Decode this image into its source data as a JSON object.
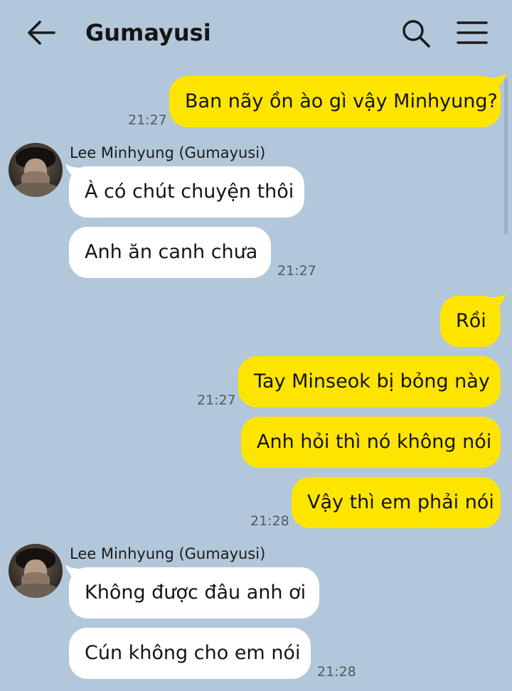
{
  "header": {
    "title": "Gumayusi",
    "back_icon": "arrow-left-icon",
    "search_icon": "search-icon",
    "menu_icon": "hamburger-menu-icon"
  },
  "colors": {
    "background": "#b2c7da",
    "my_bubble": "#fee500",
    "their_bubble": "#ffffff"
  },
  "messages": [
    {
      "side": "me",
      "text": "Ban nãy ồn ào gì vậy Minhyung?",
      "time": "21:27"
    },
    {
      "side": "them",
      "sender": "Lee Minhyung (Gumayusi)",
      "text": "À có chút chuyện thôi"
    },
    {
      "side": "them",
      "text": "Anh ăn canh chưa",
      "time": "21:27"
    },
    {
      "side": "me",
      "text": "Rồi"
    },
    {
      "side": "me",
      "text": "Tay Minseok bị bỏng này",
      "time": "21:27"
    },
    {
      "side": "me",
      "text": "Anh hỏi thì nó không nói"
    },
    {
      "side": "me",
      "text": "Vậy thì em phải nói",
      "time": "21:28"
    },
    {
      "side": "them",
      "sender": "Lee Minhyung (Gumayusi)",
      "text": "Không được đâu anh ơi"
    },
    {
      "side": "them",
      "text": "Cún không cho em nói",
      "time": "21:28"
    }
  ]
}
